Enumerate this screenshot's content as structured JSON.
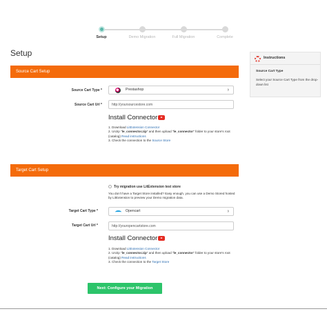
{
  "stepper": {
    "steps": [
      {
        "label": "Setup"
      },
      {
        "label": "Demo Migration"
      },
      {
        "label": "Full Migration"
      },
      {
        "label": "Complete"
      }
    ]
  },
  "page_title": "Setup",
  "source": {
    "header": "Source Cart Setup",
    "cart_type_label": "Source Cart Type *",
    "cart_type_value": "Prestashop",
    "cart_url_label": "Source Cart Url *",
    "cart_url_value": "http://yoursourcestore.com",
    "connector_title": "Install Connector",
    "step1_prefix": "1. Download ",
    "step1_link": "LitExtension Connector",
    "step2_a": "2. Unzip \"",
    "step2_b": "le_connector.zip",
    "step2_c": "\" and then upload \"",
    "step2_d": "le_connector",
    "step2_e": "\" folder to your store's root (catalog) ",
    "step2_link": "Read instructions",
    "step3_prefix": "3. Check the connection to the ",
    "step3_link": "Source Store"
  },
  "target": {
    "header": "Target Cart Setup",
    "test_store_label": "Try migration use LitExtension test store",
    "test_store_desc": "You don't have a Target Store installed? Easy enough, you can use a Demo Stored hosted by LitExtension to preview your Demo migration data.",
    "cart_type_label": "Target Cart Type *",
    "cart_type_value": "Opencart",
    "cart_url_label": "Target Cart Url *",
    "cart_url_value": "http://youropencartstore.com",
    "connector_title": "Install Connector",
    "step1_prefix": "1. Download ",
    "step1_link": "LitExtension Connector",
    "step2_a": "2. Unzip \"",
    "step2_b": "le_connector.zip",
    "step2_c": "\" and then upload \"",
    "step2_d": "le_connector",
    "step2_e": "\" folder to your store's root (catalog) ",
    "step2_link": "Read instructions",
    "step3_prefix": "3. Check the connection to the ",
    "step3_link": "Target Store"
  },
  "next_button": "Next: Configure your Migration",
  "instructions": {
    "title": "Instructions",
    "subtitle": "Source Cart Type",
    "text": "Select your Source Cart Type from the drop-down list"
  },
  "colors": {
    "accent_orange": "#f46b0b",
    "button_green": "#2cc46a",
    "step_active": "#5bb7a9",
    "link_blue": "#2b6cb0"
  },
  "icons": {
    "prestashop": "prestashop-logo-icon",
    "opencart": "opencart-logo-icon",
    "youtube": "youtube-icon",
    "instructions": "lifebuoy-icon"
  }
}
